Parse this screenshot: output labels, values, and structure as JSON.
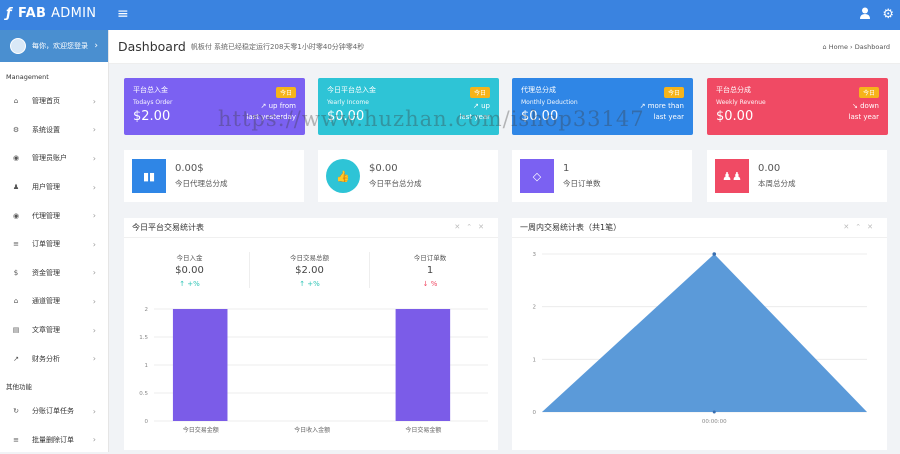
{
  "topbar": {
    "brand": "FAB",
    "brand_suffix": "ADMIN",
    "menu_icon": "≡"
  },
  "sidebar": {
    "profile": "每你，欢迎您登录",
    "section_main": "Management",
    "items": [
      {
        "label": "管理首页",
        "icon": "home-icon",
        "glyph": "⌂"
      },
      {
        "label": "系统设置",
        "icon": "gears-icon",
        "glyph": "⚙"
      },
      {
        "label": "管理员账户",
        "icon": "user-circle-icon",
        "glyph": "◉"
      },
      {
        "label": "用户管理",
        "icon": "users-icon",
        "glyph": "♟"
      },
      {
        "label": "代理管理",
        "icon": "user-icon",
        "glyph": "◉"
      },
      {
        "label": "订单管理",
        "icon": "list-icon",
        "glyph": "≡"
      },
      {
        "label": "资金管理",
        "icon": "money-bag-icon",
        "glyph": "$"
      },
      {
        "label": "通道管理",
        "icon": "bank-icon",
        "glyph": "⌂"
      },
      {
        "label": "文章管理",
        "icon": "book-icon",
        "glyph": "▤"
      },
      {
        "label": "财务分析",
        "icon": "chart-line-icon",
        "glyph": "↗"
      }
    ],
    "section_tools": "其他功能",
    "tools": [
      {
        "label": "分账订单任务",
        "icon": "refresh-icon",
        "glyph": "↻"
      },
      {
        "label": "批量删除订单",
        "icon": "list-icon",
        "glyph": "≡"
      }
    ]
  },
  "header": {
    "title": "Dashboard",
    "subtitle": "帆板付 系统已经稳定运行208天零1小时零40分钟零4秒",
    "breadcrumb_home": "Home",
    "breadcrumb_sep": "›",
    "breadcrumb_current": "Dashboard"
  },
  "cards": [
    {
      "title": "平台总入金",
      "badge": "今日",
      "sub": "Todays Order",
      "value": "$2.00",
      "trend1": "↗ up from",
      "trend2": "last yesterday",
      "color": "#7b61f2"
    },
    {
      "title": "今日平台总入金",
      "badge": "今日",
      "sub": "Yearly Income",
      "value": "$0.00",
      "trend1": "↗ up",
      "trend2": "last year",
      "color": "#2ec4d6"
    },
    {
      "title": "代理总分成",
      "badge": "今日",
      "sub": "Monthly Deduction",
      "value": "$0.00",
      "trend1": "↗ more than",
      "trend2": "last year",
      "color": "#2f86e6"
    },
    {
      "title": "平台总分成",
      "badge": "今日",
      "sub": "Weekly Revenue",
      "value": "$0.00",
      "trend1": "↘ down",
      "trend2": "last year",
      "color": "#f04a64"
    }
  ],
  "stats": [
    {
      "value": "0.00$",
      "label": "今日代理总分成",
      "color": "#2f86e6",
      "icon": "bar-chart-icon",
      "glyph": "▮▮"
    },
    {
      "value": "$0.00",
      "label": "今日平台总分成",
      "color": "#2ec4d6",
      "icon": "thumbs-up-icon",
      "glyph": "👍"
    },
    {
      "value": "1",
      "label": "今日订单数",
      "color": "#7b61f2",
      "icon": "shopping-bag-icon",
      "glyph": "◇"
    },
    {
      "value": "0.00",
      "label": "本周总分成",
      "color": "#f04a64",
      "icon": "users-icon",
      "glyph": "♟♟"
    }
  ],
  "panel_left": {
    "title": "今日平台交易统计表",
    "kpis": [
      {
        "label": "今日入金",
        "value": "$0.00",
        "trend": "↑ +%",
        "trend_color": "#2ec4b6"
      },
      {
        "label": "今日交易总额",
        "value": "$2.00",
        "trend": "↑ +%",
        "trend_color": "#2ec4b6"
      },
      {
        "label": "今日订单数",
        "value": "1",
        "trend": "↓ %",
        "trend_color": "#f04a64"
      }
    ]
  },
  "panel_right": {
    "title": "一周内交易统计表（共1笔）"
  },
  "watermark": "https://www.huzhan.com/ishop33147",
  "chart_data": [
    {
      "type": "bar",
      "categories": [
        "今日交易金额",
        "今日收入金额",
        "今日交易金额"
      ],
      "values": [
        2,
        0,
        2
      ],
      "ylim": [
        0,
        2
      ],
      "yticks": [
        "0",
        "0.5",
        "1",
        "1.5",
        "2"
      ],
      "color": "#7b5ce8",
      "grid": true
    },
    {
      "type": "area",
      "x": [
        "00:00:00"
      ],
      "peak": 3,
      "ylim": [
        0,
        3
      ],
      "yticks": [
        "0",
        "0.5",
        "1",
        "1.5",
        "2",
        "2.5",
        "3"
      ],
      "color": "#5b9ad9",
      "grid": true
    }
  ]
}
